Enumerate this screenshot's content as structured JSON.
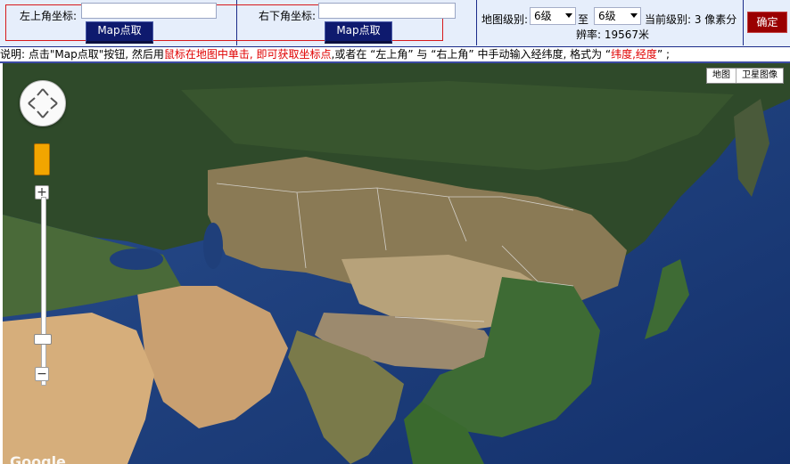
{
  "coords": {
    "top_left_label": "左上角坐标:",
    "top_left_value": "",
    "top_left_button": "Map点取",
    "bottom_right_label": "右下角坐标:",
    "bottom_right_value": "",
    "bottom_right_button": "Map点取"
  },
  "levels": {
    "label": "地图级别:",
    "from_value": "6级",
    "to_label": "至",
    "to_value": "6级",
    "current_label": "当前级别: 3 像素分",
    "resolution": "辨率: 19567米",
    "confirm": "确定"
  },
  "instructions": {
    "part1": "说明: 点击\"Map点取\"按钮, 然后用",
    "part2_red": "鼠标在地图中单击, 即可获取坐标点",
    "part3": ",或者在 “左上角” 与 “右上角” 中手动输入经纬度, 格式为 “",
    "part4_red": "纬度,经度",
    "part5": "” ;"
  },
  "map": {
    "type_map": "地图",
    "type_satellite": "卫星图像",
    "zoom_in": "+",
    "zoom_out": "−",
    "attribution": "Google"
  },
  "colors": {
    "button_bg": "#0e1a6e",
    "confirm_bg": "#9a0000",
    "accent_red": "#d7191c"
  }
}
